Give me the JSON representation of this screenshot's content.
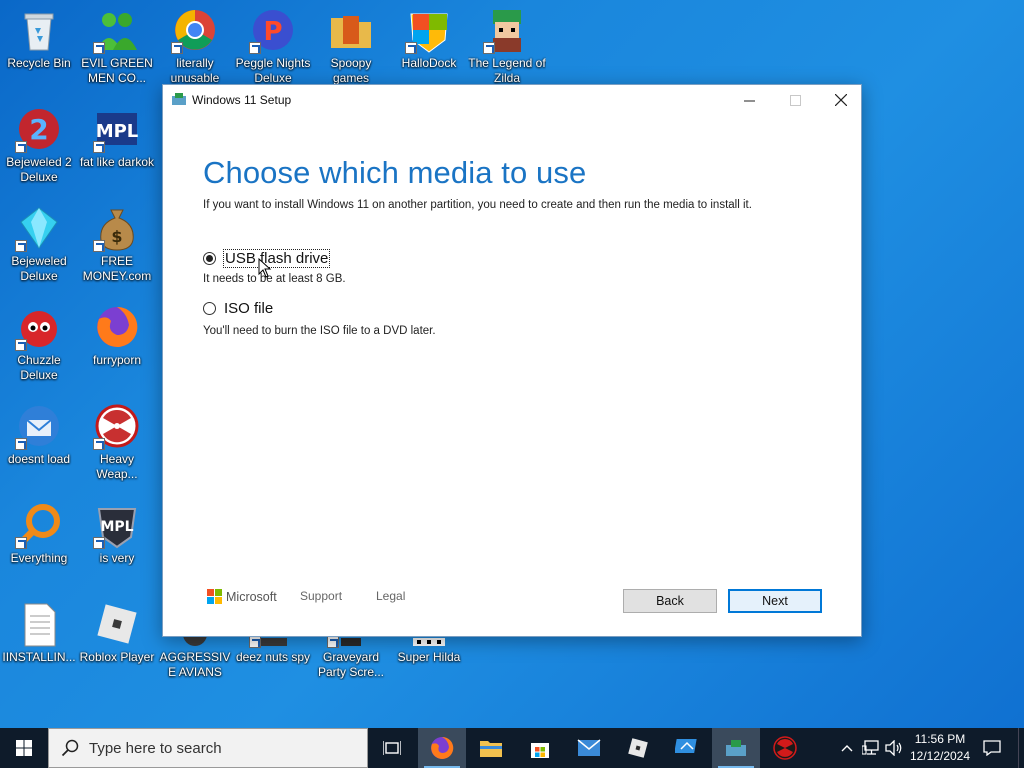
{
  "desktop": {
    "icons": [
      {
        "label": "Recycle Bin",
        "icon": "recycle-bin-icon"
      },
      {
        "label": "EVIL GREEN MEN CO...",
        "icon": "green-men-icon"
      },
      {
        "label": "literally unusable",
        "icon": "chrome-icon"
      },
      {
        "label": "Peggle Nights Deluxe",
        "icon": "peggle-icon"
      },
      {
        "label": "Spoopy games",
        "icon": "games-folder-icon"
      },
      {
        "label": "HalloDock",
        "icon": "hallodock-icon"
      },
      {
        "label": "The Legend of Zilda",
        "icon": "zilda-icon"
      },
      {
        "label": "Bejeweled 2 Deluxe",
        "icon": "bejeweled-2-icon"
      },
      {
        "label": "fat like darkok",
        "icon": "mpl-logo-icon"
      },
      {
        "label": "Bejeweled Deluxe",
        "icon": "gem-icon"
      },
      {
        "label": "FREE MONEY.com",
        "icon": "money-bag-icon"
      },
      {
        "label": "Chuzzle Deluxe",
        "icon": "chuzzle-icon"
      },
      {
        "label": "furryporn",
        "icon": "firefox-icon"
      },
      {
        "label": "doesnt load",
        "icon": "thunderbird-icon"
      },
      {
        "label": "Heavy Weap...",
        "icon": "radiation-icon"
      },
      {
        "label": "Everything",
        "icon": "everything-search-icon"
      },
      {
        "label": "is very",
        "icon": "mpl-shield-icon"
      },
      {
        "label": "IINSTALLIN...",
        "icon": "text-file-icon"
      },
      {
        "label": "Roblox Player",
        "icon": "roblox-icon"
      },
      {
        "label": "AGGRESSIVE AVIANS",
        "icon": "avians-icon"
      },
      {
        "label": "deez nuts spy",
        "icon": "spy-icon"
      },
      {
        "label": "Graveyard Party Scre...",
        "icon": "graveyard-icon"
      },
      {
        "label": "Super Hilda",
        "icon": "hilda-icon"
      }
    ]
  },
  "window": {
    "title": "Windows 11 Setup",
    "heading": "Choose which media to use",
    "subtitle": "If you want to install Windows 11 on another partition, you need to create and then run the media to install it.",
    "options": [
      {
        "label": "USB flash drive",
        "description": "It needs to be at least 8 GB.",
        "selected": true
      },
      {
        "label": "ISO file",
        "description": "You'll need to burn the ISO file to a DVD later.",
        "selected": false
      }
    ],
    "footer": {
      "brand": "Microsoft",
      "support": "Support",
      "legal": "Legal",
      "back": "Back",
      "next": "Next"
    }
  },
  "taskbar": {
    "search_placeholder": "Type here to search",
    "apps": [
      "task-view-icon",
      "firefox-icon",
      "file-explorer-icon",
      "store-icon",
      "mail-icon",
      "roblox-icon",
      "remote-desktop-icon",
      "media-creation-tool-icon",
      "radiation-icon"
    ],
    "time": "11:56 PM",
    "date": "12/12/2024"
  },
  "colors": {
    "accent": "#0078d7",
    "heading": "#1a74c4",
    "taskbar": "#0e1b2a"
  }
}
